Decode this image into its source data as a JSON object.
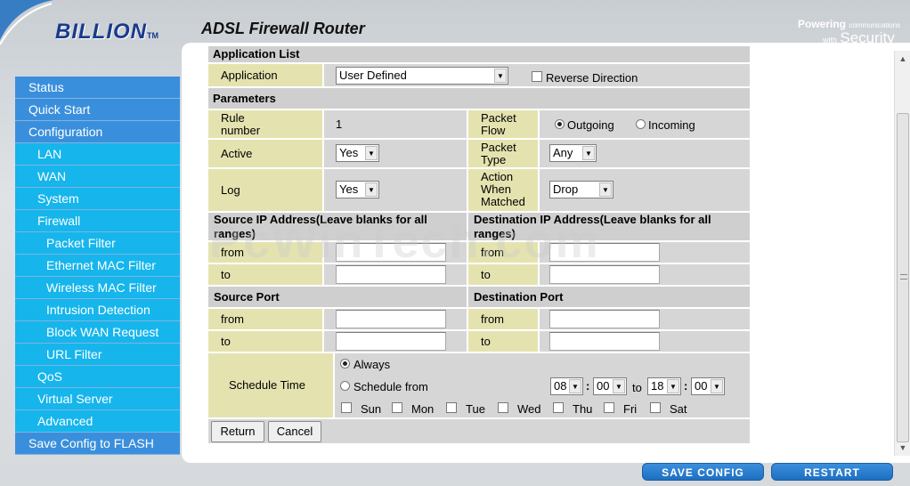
{
  "header": {
    "logo": "BILLION",
    "logo_tm": "TM",
    "title": "ADSL Firewall Router",
    "tagline_line1": "Powering",
    "tagline_small": "communications",
    "tagline_with": "with",
    "tagline_security": "Security"
  },
  "watermark": "PcWinTech.com",
  "sidebar": {
    "items": [
      {
        "label": "Status",
        "level": 0
      },
      {
        "label": "Quick Start",
        "level": 0
      },
      {
        "label": "Configuration",
        "level": 0
      },
      {
        "label": "LAN",
        "level": 1
      },
      {
        "label": "WAN",
        "level": 1
      },
      {
        "label": "System",
        "level": 1
      },
      {
        "label": "Firewall",
        "level": 1
      },
      {
        "label": "Packet Filter",
        "level": 2
      },
      {
        "label": "Ethernet MAC Filter",
        "level": 2
      },
      {
        "label": "Wireless MAC Filter",
        "level": 2
      },
      {
        "label": "Intrusion Detection",
        "level": 2
      },
      {
        "label": "Block WAN Request",
        "level": 2
      },
      {
        "label": "URL Filter",
        "level": 2
      },
      {
        "label": "QoS",
        "level": 1
      },
      {
        "label": "Virtual Server",
        "level": 1
      },
      {
        "label": "Advanced",
        "level": 1
      },
      {
        "label": "Save Config to FLASH",
        "level": 0
      }
    ]
  },
  "form": {
    "app_list_header": "Application List",
    "application_label": "Application",
    "application_value": "User Defined",
    "reverse_direction_label": "Reverse Direction",
    "parameters_header": "Parameters",
    "rule_number_label_1": "Rule",
    "rule_number_label_2": "number",
    "rule_number_value": "1",
    "packet_flow_label_1": "Packet",
    "packet_flow_label_2": "Flow",
    "outgoing_label": "Outgoing",
    "incoming_label": "Incoming",
    "active_label": "Active",
    "active_value": "Yes",
    "packet_type_label_1": "Packet",
    "packet_type_label_2": "Type",
    "packet_type_value": "Any",
    "log_label": "Log",
    "log_value": "Yes",
    "action_label_1": "Action",
    "action_label_2": "When",
    "action_label_3": "Matched",
    "action_value": "Drop",
    "src_ip_header_1": "Source IP Address(Leave blanks for all",
    "src_ip_header_2": "ranges)",
    "dst_ip_header_1": "Destination IP Address(Leave blanks for all",
    "dst_ip_header_2": "ranges)",
    "from_label": "from",
    "to_label": "to",
    "src_port_header": "Source Port",
    "dst_port_header": "Destination Port",
    "schedule_label": "Schedule Time",
    "always_label": "Always",
    "schedule_from_label": "Schedule from",
    "start_hour": "08",
    "start_min": "00",
    "to_word": "to",
    "end_hour": "18",
    "end_min": "00",
    "colon": ":",
    "days": [
      "Sun",
      "Mon",
      "Tue",
      "Wed",
      "Thu",
      "Fri",
      "Sat"
    ],
    "return_button": "Return",
    "cancel_button": "Cancel"
  },
  "bottom": {
    "save_config": "SAVE CONFIG",
    "restart": "RESTART"
  }
}
